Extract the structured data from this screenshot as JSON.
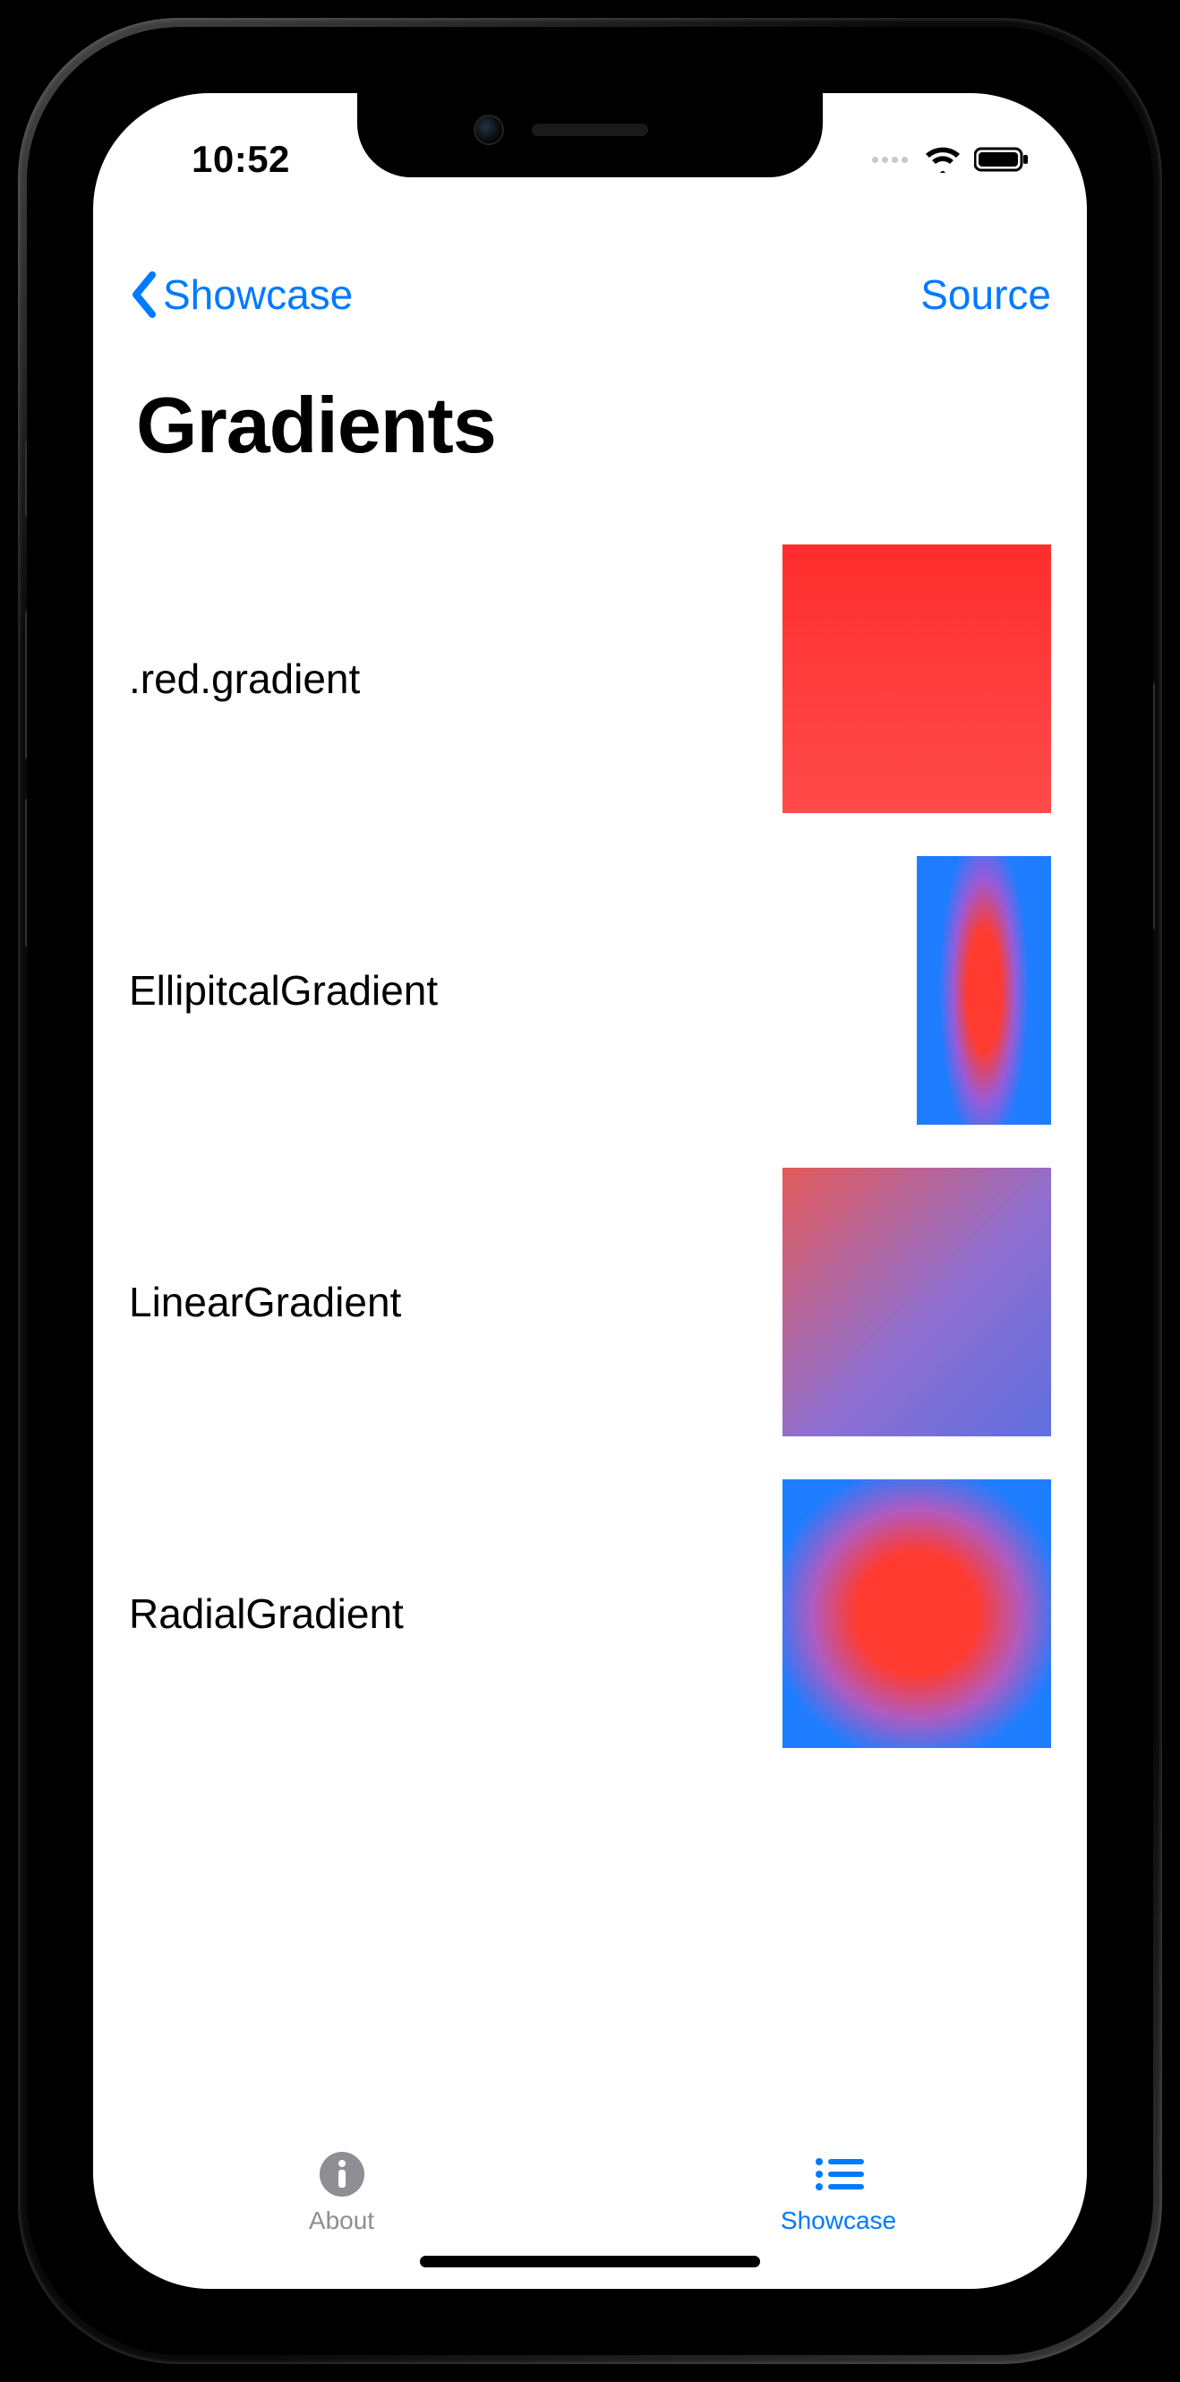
{
  "status": {
    "time": "10:52"
  },
  "nav": {
    "back_label": "Showcase",
    "right_label": "Source"
  },
  "page": {
    "title": "Gradients"
  },
  "rows": [
    {
      "label": ".red.gradient"
    },
    {
      "label": "EllipitcalGradient"
    },
    {
      "label": "LinearGradient"
    },
    {
      "label": "RadialGradient"
    }
  ],
  "tabs": {
    "about": "About",
    "showcase": "Showcase"
  },
  "colors": {
    "tint": "#007aff",
    "red": "#ff3b30",
    "blue": "#1e7dff"
  }
}
